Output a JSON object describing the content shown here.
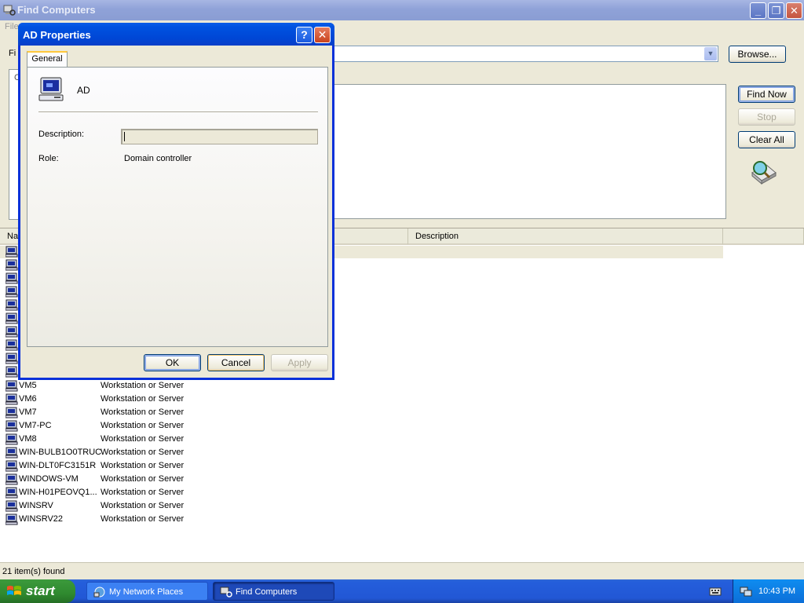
{
  "main_window": {
    "title": "Find Computers",
    "menu_file": "File",
    "find_label": "Fi",
    "browse_label": "Browse...",
    "find_now_label": "Find Now",
    "stop_label": "Stop",
    "clear_all_label": "Clear All",
    "tab_stub": "C",
    "columns": [
      "Na",
      "Description"
    ],
    "rows": [
      {
        "name": "VM5",
        "type": "Workstation or Server"
      },
      {
        "name": "VM6",
        "type": "Workstation or Server"
      },
      {
        "name": "VM7",
        "type": "Workstation or Server"
      },
      {
        "name": "VM7-PC",
        "type": "Workstation or Server"
      },
      {
        "name": "VM8",
        "type": "Workstation or Server"
      },
      {
        "name": "WIN-BULB1O0TRUC",
        "type": "Workstation or Server"
      },
      {
        "name": "WIN-DLT0FC3151R",
        "type": "Workstation or Server"
      },
      {
        "name": "WINDOWS-VM",
        "type": "Workstation or Server"
      },
      {
        "name": "WIN-H01PEOVQ1...",
        "type": "Workstation or Server"
      },
      {
        "name": "WINSRV",
        "type": "Workstation or Server"
      },
      {
        "name": "WINSRV22",
        "type": "Workstation or Server"
      }
    ],
    "status": "21 item(s) found"
  },
  "dialog": {
    "title": "AD Properties",
    "tab_general": "General",
    "computer_name": "AD",
    "description_label": "Description:",
    "description_value": "",
    "role_label": "Role:",
    "role_value": "Domain controller",
    "ok_label": "OK",
    "cancel_label": "Cancel",
    "apply_label": "Apply"
  },
  "taskbar": {
    "start_label": "start",
    "tasks": [
      {
        "label": "My Network Places"
      },
      {
        "label": "Find Computers"
      }
    ],
    "clock": "10:43 PM"
  },
  "colors": {
    "dialog_title": "#0046d5",
    "taskbar": "#245edb",
    "start_button": "#2f8a2f",
    "window_face": "#ece9d8"
  }
}
